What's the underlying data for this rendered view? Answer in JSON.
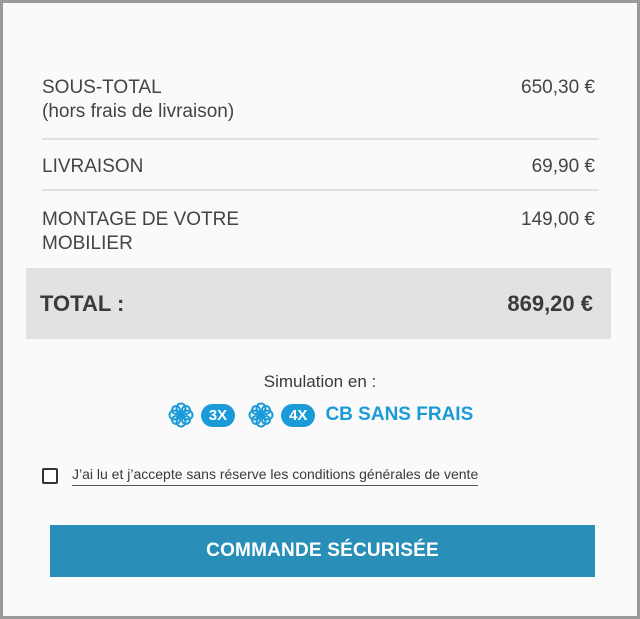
{
  "summary": {
    "subtotal": {
      "label": "SOUS-TOTAL",
      "sublabel": "(hors frais de livraison)",
      "value": "650,30 €"
    },
    "shipping": {
      "label": "LIVRAISON",
      "value": "69,90 €"
    },
    "assembly": {
      "label": "MONTAGE DE VOTRE MOBILIER",
      "value": "149,00 €"
    },
    "total": {
      "label": "TOTAL :",
      "value": "869,20 €"
    }
  },
  "simulation": {
    "title": "Simulation en :",
    "options": [
      "3X",
      "4X"
    ],
    "suffix": "CB SANS FRAIS",
    "icon": "flower-icon",
    "accent": "#1a9bd8"
  },
  "terms": {
    "label": "J’ai lu et j’accepte sans réserve les conditions générales de vente",
    "checked": false
  },
  "cta": {
    "label": "COMMANDE SÉCURISÉE",
    "color": "#2a8fb8"
  }
}
